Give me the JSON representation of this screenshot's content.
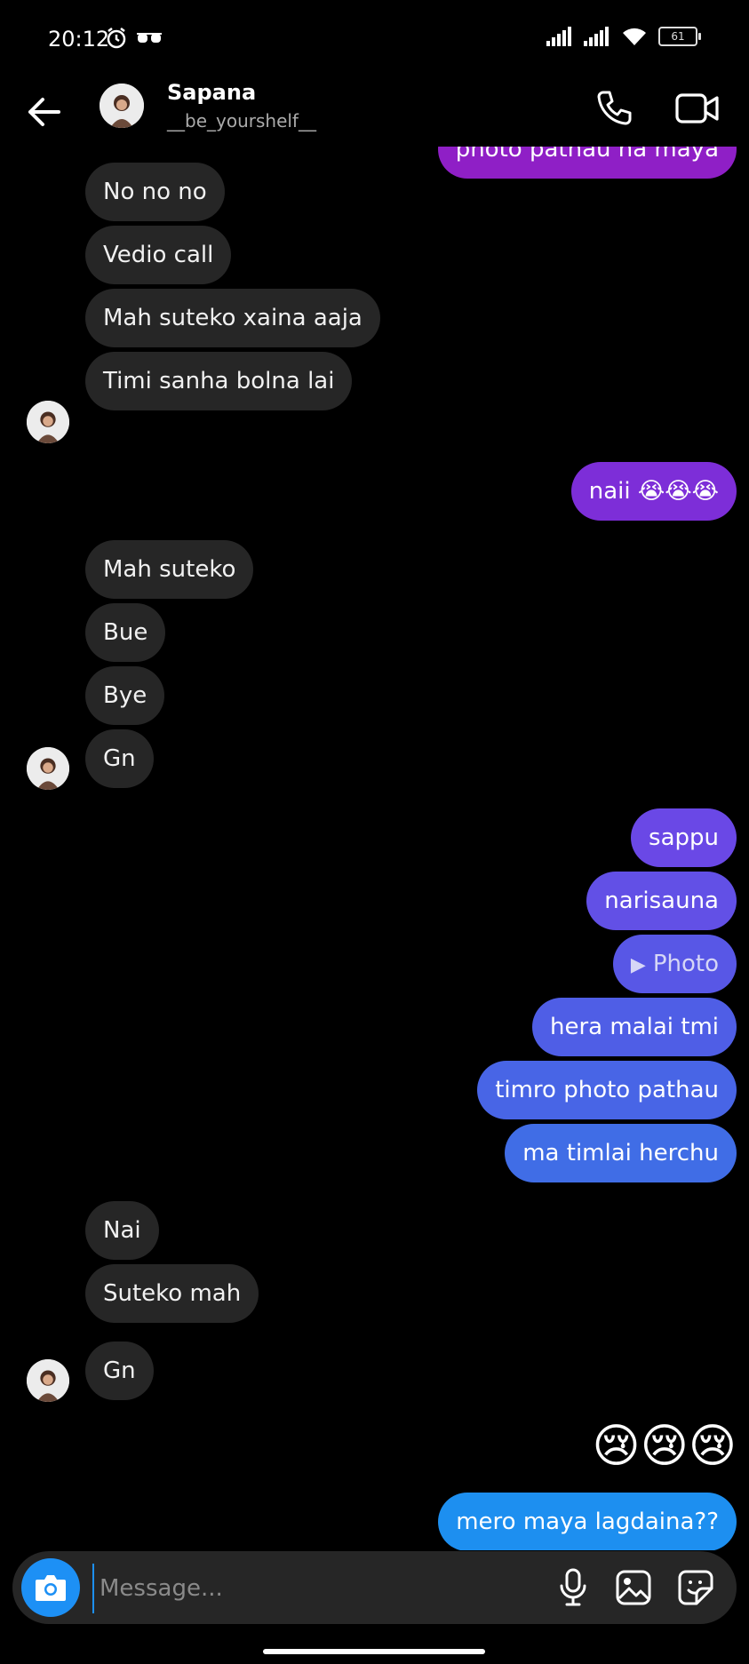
{
  "status_bar": {
    "time": "20:12",
    "battery": "61"
  },
  "header": {
    "name": "Sapana",
    "handle": "__be_yourshelf__"
  },
  "messages": [
    {
      "text": "photo pathau na maya",
      "side": "out",
      "color": "#8f1fc6"
    },
    {
      "text": "No no no",
      "side": "in"
    },
    {
      "text": "Vedio call",
      "side": "in"
    },
    {
      "text": "Mah suteko xaina aaja",
      "side": "in"
    },
    {
      "text": "Timi sanha bolna lai",
      "side": "in"
    },
    {
      "text": "naii 😭😭😭",
      "side": "out",
      "color": "#7d2ed8"
    },
    {
      "text": "Mah suteko",
      "side": "in"
    },
    {
      "text": "Bue",
      "side": "in"
    },
    {
      "text": "Bye",
      "side": "in"
    },
    {
      "text": "Gn",
      "side": "in"
    },
    {
      "text": "sappu",
      "side": "out",
      "color": "#6a48e6"
    },
    {
      "text": "narisauna",
      "side": "out",
      "color": "#6250e6"
    },
    {
      "text": "Photo",
      "side": "out",
      "color": "#5857e6",
      "icon": "play-icon"
    },
    {
      "text": "hera malai tmi",
      "side": "out",
      "color": "#4f5ee6"
    },
    {
      "text": "timro photo pathau",
      "side": "out",
      "color": "#4865e6"
    },
    {
      "text": "ma timlai herchu",
      "side": "out",
      "color": "#406de6"
    },
    {
      "text": "Nai",
      "side": "in"
    },
    {
      "text": "Suteko mah",
      "side": "in"
    },
    {
      "text": "Gn",
      "side": "in"
    },
    {
      "text": "😢😢😢",
      "side": "out",
      "type": "emoji"
    },
    {
      "text": "mero maya lagdaina??",
      "side": "out",
      "color": "#1d8ff0"
    }
  ],
  "composer": {
    "placeholder": "Message..."
  },
  "colors": {
    "incoming_bubble": "#262626",
    "accent": "#1d90f5",
    "background": "#000000"
  }
}
